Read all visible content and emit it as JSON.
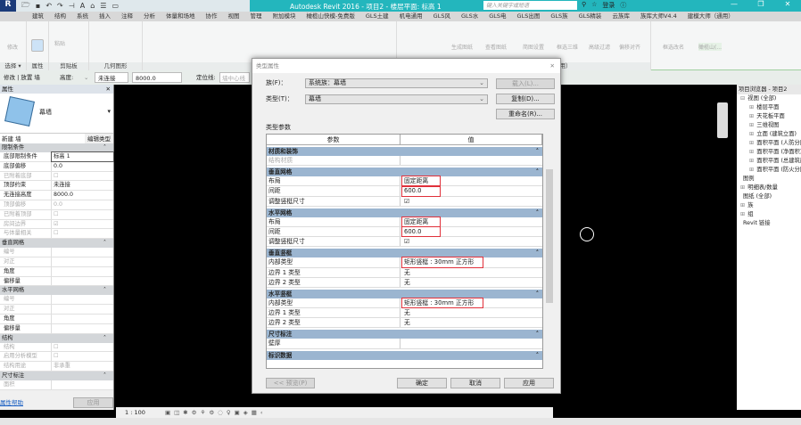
{
  "app": {
    "title": "Autodesk Revit 2016 -   项目2 - 楼层平面: 标高 1",
    "search_placeholder": "键入关键字或短语",
    "login": "登录"
  },
  "tabs": [
    "建筑",
    "结构",
    "系统",
    "插入",
    "注释",
    "分析",
    "体量和场地",
    "协作",
    "视图",
    "管理",
    "附加模块",
    "橄榄山快模-免费版",
    "GLS土建",
    "机电通用",
    "GLS风",
    "GLS水",
    "GLS电",
    "GLS出图",
    "GLS族",
    "GLS精装",
    "云族库",
    "族库大师V4.4",
    "建模大师（通用）"
  ],
  "ribbon": {
    "panels": [
      "选择 ▾",
      "属性",
      "剪贴板",
      "几何图形",
      "修改",
      "建模大师（通用）"
    ],
    "tools": {
      "modify": "修改",
      "paste": "粘贴",
      "gen_sheet": "生成图纸",
      "view_sheet": "查看图纸",
      "sheet_settings": "简图设置",
      "box_3d": "框选三维",
      "adv_filter": "高级过滤",
      "offset_align": "偏移对齐",
      "rename": "框选改名",
      "olive": "橄榄山(..."
    }
  },
  "options": {
    "context": "修改 | 放置 墙",
    "height_label": "高度:",
    "height_mode": "未连接",
    "height_value": "8000.0",
    "loc_label": "定位线:",
    "loc_value": "墙中心线"
  },
  "properties": {
    "title": "属性",
    "type_name": "幕墙",
    "instance_selector": "新建 墙",
    "edit_type": "编辑类型",
    "sections": [
      {
        "name": "限制条件",
        "rows": [
          [
            "底部限制条件",
            "标高 1",
            ""
          ],
          [
            "底部偏移",
            "0.0",
            ""
          ],
          [
            "已附着底部",
            "☐",
            "dim"
          ],
          [
            "顶部约束",
            "未连接",
            ""
          ],
          [
            "无连接高度",
            "8000.0",
            ""
          ],
          [
            "顶部偏移",
            "0.0",
            "dim"
          ],
          [
            "已附着顶部",
            "☐",
            "dim"
          ],
          [
            "房间边界",
            "☑",
            "dim"
          ],
          [
            "与体量相关",
            "☐",
            "dim"
          ]
        ]
      },
      {
        "name": "垂直网格",
        "rows": [
          [
            "编号",
            "",
            "dim"
          ],
          [
            "对正",
            "",
            "dim"
          ],
          [
            "角度",
            "",
            ""
          ],
          [
            "偏移量",
            "",
            ""
          ]
        ]
      },
      {
        "name": "水平网格",
        "rows": [
          [
            "编号",
            "",
            "dim"
          ],
          [
            "对正",
            "",
            "dim"
          ],
          [
            "角度",
            "",
            ""
          ],
          [
            "偏移量",
            "",
            ""
          ]
        ]
      },
      {
        "name": "结构",
        "rows": [
          [
            "结构",
            "☐",
            "dim"
          ],
          [
            "启用分析模型",
            "☐",
            "dim"
          ],
          [
            "结构用途",
            "非承重",
            "dim"
          ]
        ]
      },
      {
        "name": "尺寸标注",
        "rows": [
          [
            "面积",
            "",
            "dim"
          ]
        ]
      }
    ],
    "help_link": "属性帮助",
    "apply": "应用"
  },
  "dialog": {
    "title": "类型属性",
    "family_label": "族(F)：",
    "family_value": "系统族：幕墙",
    "type_label": "类型(T)：",
    "type_value": "幕墙",
    "load": "载入(L)...",
    "duplicate": "复制(D)...",
    "rename": "重命名(R)...",
    "params_label": "类型参数",
    "col_param": "参数",
    "col_value": "值",
    "sections": [
      {
        "name": "材质和装饰",
        "rows": [
          [
            "结构材质",
            "",
            false,
            true
          ]
        ]
      },
      {
        "name": "垂直网格",
        "rows": [
          [
            "布局",
            "固定距离",
            true,
            false
          ],
          [
            "间距",
            "600.0",
            true,
            false
          ],
          [
            "调整竖梃尺寸",
            "☑",
            false,
            false
          ]
        ]
      },
      {
        "name": "水平网格",
        "rows": [
          [
            "布局",
            "固定距离",
            true,
            false
          ],
          [
            "间距",
            "600.0",
            true,
            false
          ],
          [
            "调整竖梃尺寸",
            "☑",
            false,
            false
          ]
        ]
      },
      {
        "name": "垂直竖梃",
        "rows": [
          [
            "内部类型",
            "矩形竖梃 : 30mm 正方形",
            true,
            false
          ],
          [
            "边界 1 类型",
            "无",
            false,
            false
          ],
          [
            "边界 2 类型",
            "无",
            false,
            false
          ]
        ]
      },
      {
        "name": "水平竖梃",
        "rows": [
          [
            "内部类型",
            "矩形竖梃 : 30mm 正方形",
            true,
            false
          ],
          [
            "边界 1 类型",
            "无",
            false,
            false
          ],
          [
            "边界 2 类型",
            "无",
            false,
            false
          ]
        ]
      },
      {
        "name": "尺寸标注",
        "rows": [
          [
            "壁厚",
            "",
            false,
            false
          ]
        ]
      },
      {
        "name": "标识数据",
        "rows": []
      }
    ],
    "preview": "<< 预览(P)",
    "ok": "确定",
    "cancel": "取消",
    "apply": "应用"
  },
  "browser": {
    "title": "项目浏览器 - 项目2",
    "items": [
      [
        "⊟",
        "视图 (全部)",
        0
      ],
      [
        "⊞",
        "楼层平面",
        1
      ],
      [
        "⊞",
        "天花板平面",
        1
      ],
      [
        "⊞",
        "三维视图",
        1
      ],
      [
        "⊞",
        "立面 (建筑立面)",
        1
      ],
      [
        "⊞",
        "面积平面 (人防分区面积)",
        1
      ],
      [
        "⊞",
        "面积平面 (净面积)",
        1
      ],
      [
        "⊞",
        "面积平面 (总建筑面积)",
        1
      ],
      [
        "⊞",
        "面积平面 (防火分区面积)",
        1
      ],
      [
        "",
        "图例",
        0
      ],
      [
        "⊞",
        "明细表/数量",
        0
      ],
      [
        "",
        "图纸 (全部)",
        0
      ],
      [
        "⊞",
        "族",
        0
      ],
      [
        "⊞",
        "组",
        0
      ],
      [
        "",
        "Revit 链接",
        0
      ]
    ]
  },
  "viewbar": {
    "scale": "1 : 100"
  }
}
